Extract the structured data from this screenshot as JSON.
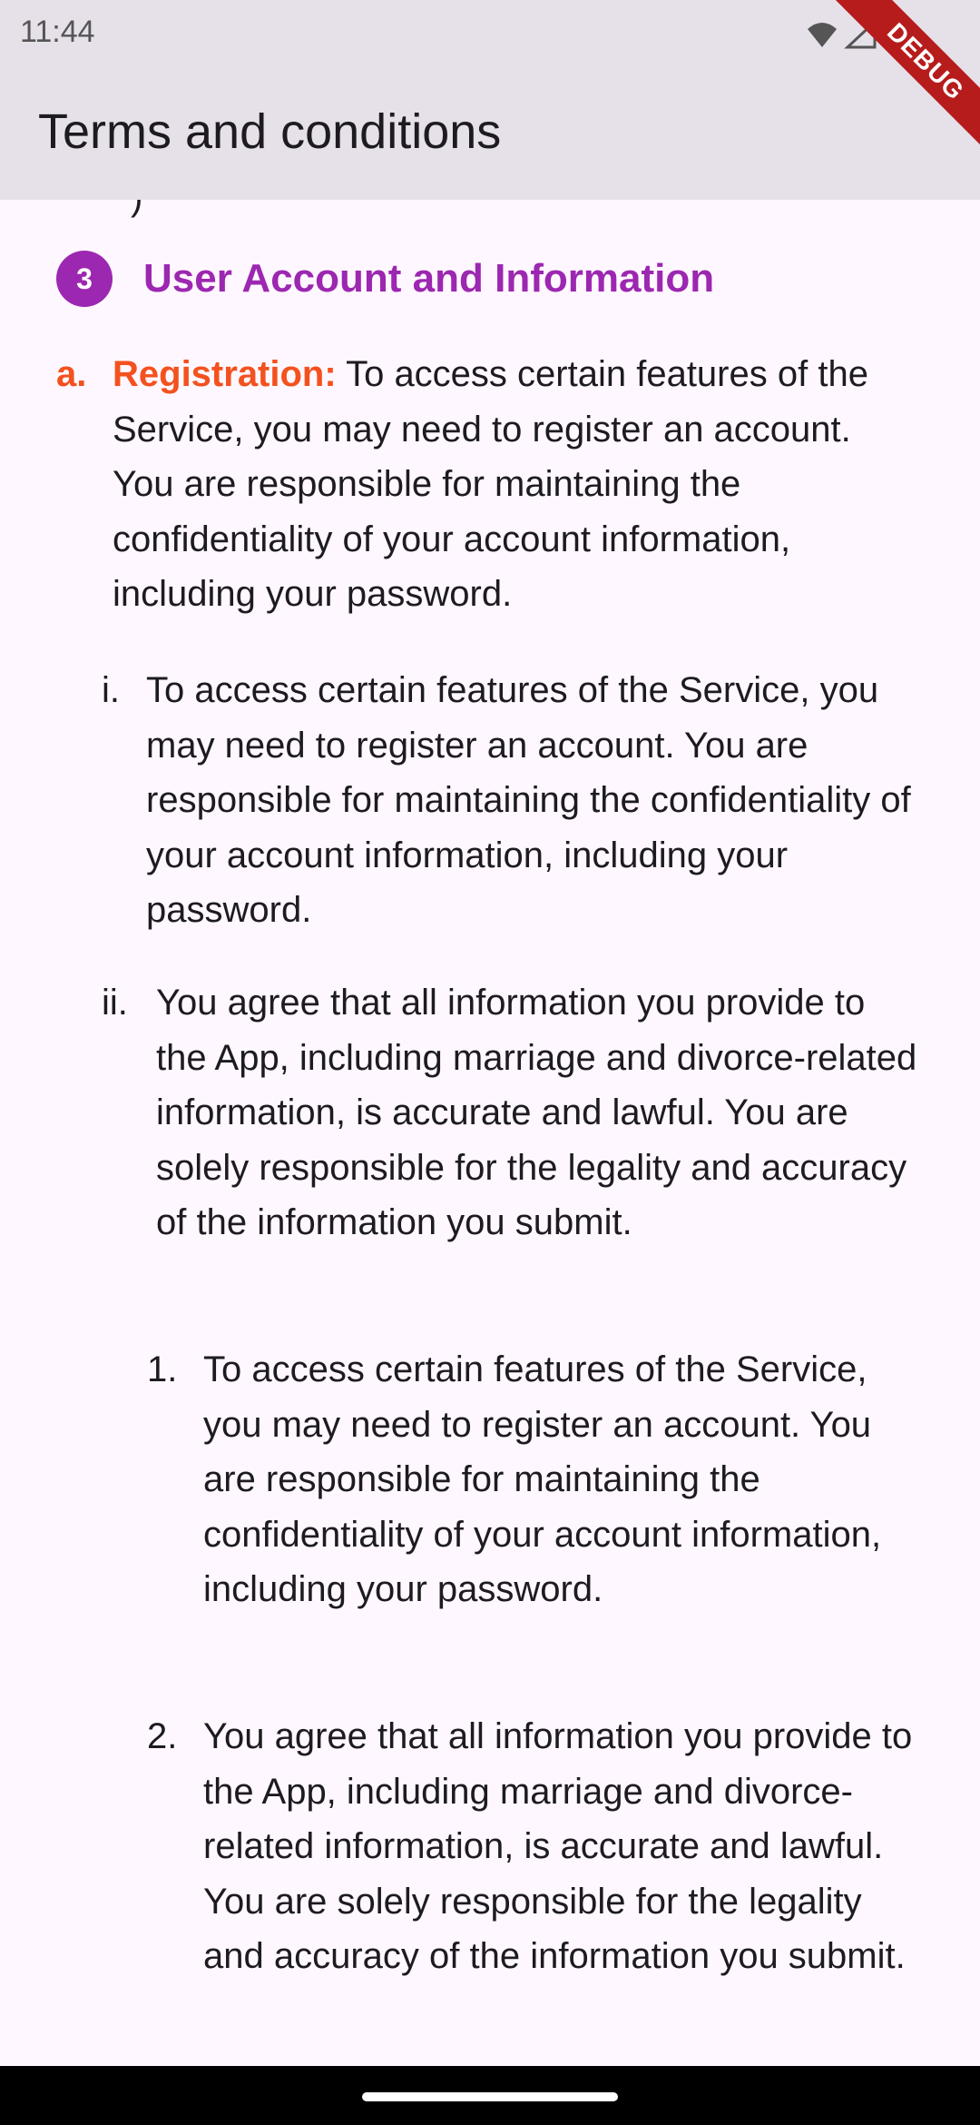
{
  "status_bar": {
    "time": "11:44",
    "icons": [
      "wifi-icon",
      "signal-icon",
      "battery-icon"
    ]
  },
  "app_bar": {
    "title": "Terms and conditions"
  },
  "debug_banner": {
    "label": "DEBUG",
    "color": "#B71C1C"
  },
  "colors": {
    "accent": "#9C27B0",
    "highlight": "#F4511E",
    "background": "#FEF7FF",
    "app_bar": "#E6E0E9",
    "text": "#1D1B20"
  },
  "content": {
    "scroll_remnant": ")",
    "section": {
      "number": "3",
      "title": "User Account and Information"
    },
    "item_a": {
      "marker": "a.",
      "lead": "Registration:",
      "text": " To access certain features of the Service, you may need to register an account. You are responsible for maintaining the confidentiality of your account information, including your password."
    },
    "item_i": {
      "marker": "i.",
      "text": "To access certain features of the Service, you may need to register an account. You are responsible for maintaining the confidentiality of your account information, including your password."
    },
    "item_ii": {
      "marker": "ii.",
      "text": "You agree that all information you provide to the App, including marriage and divorce-related information, is accurate and lawful. You are solely responsible for the legality and accuracy of the information you submit."
    },
    "item_1": {
      "marker": "1.",
      "text": "To access certain features of the Service, you may need to register an account. You are responsible for maintaining the confidentiality of your account information, including your password."
    },
    "item_2": {
      "marker": "2.",
      "text": "You agree that all information you provide to the App, including marriage and divorce-related information, is accurate and lawful. You are solely responsible for the legality and accuracy of the information you submit."
    }
  }
}
